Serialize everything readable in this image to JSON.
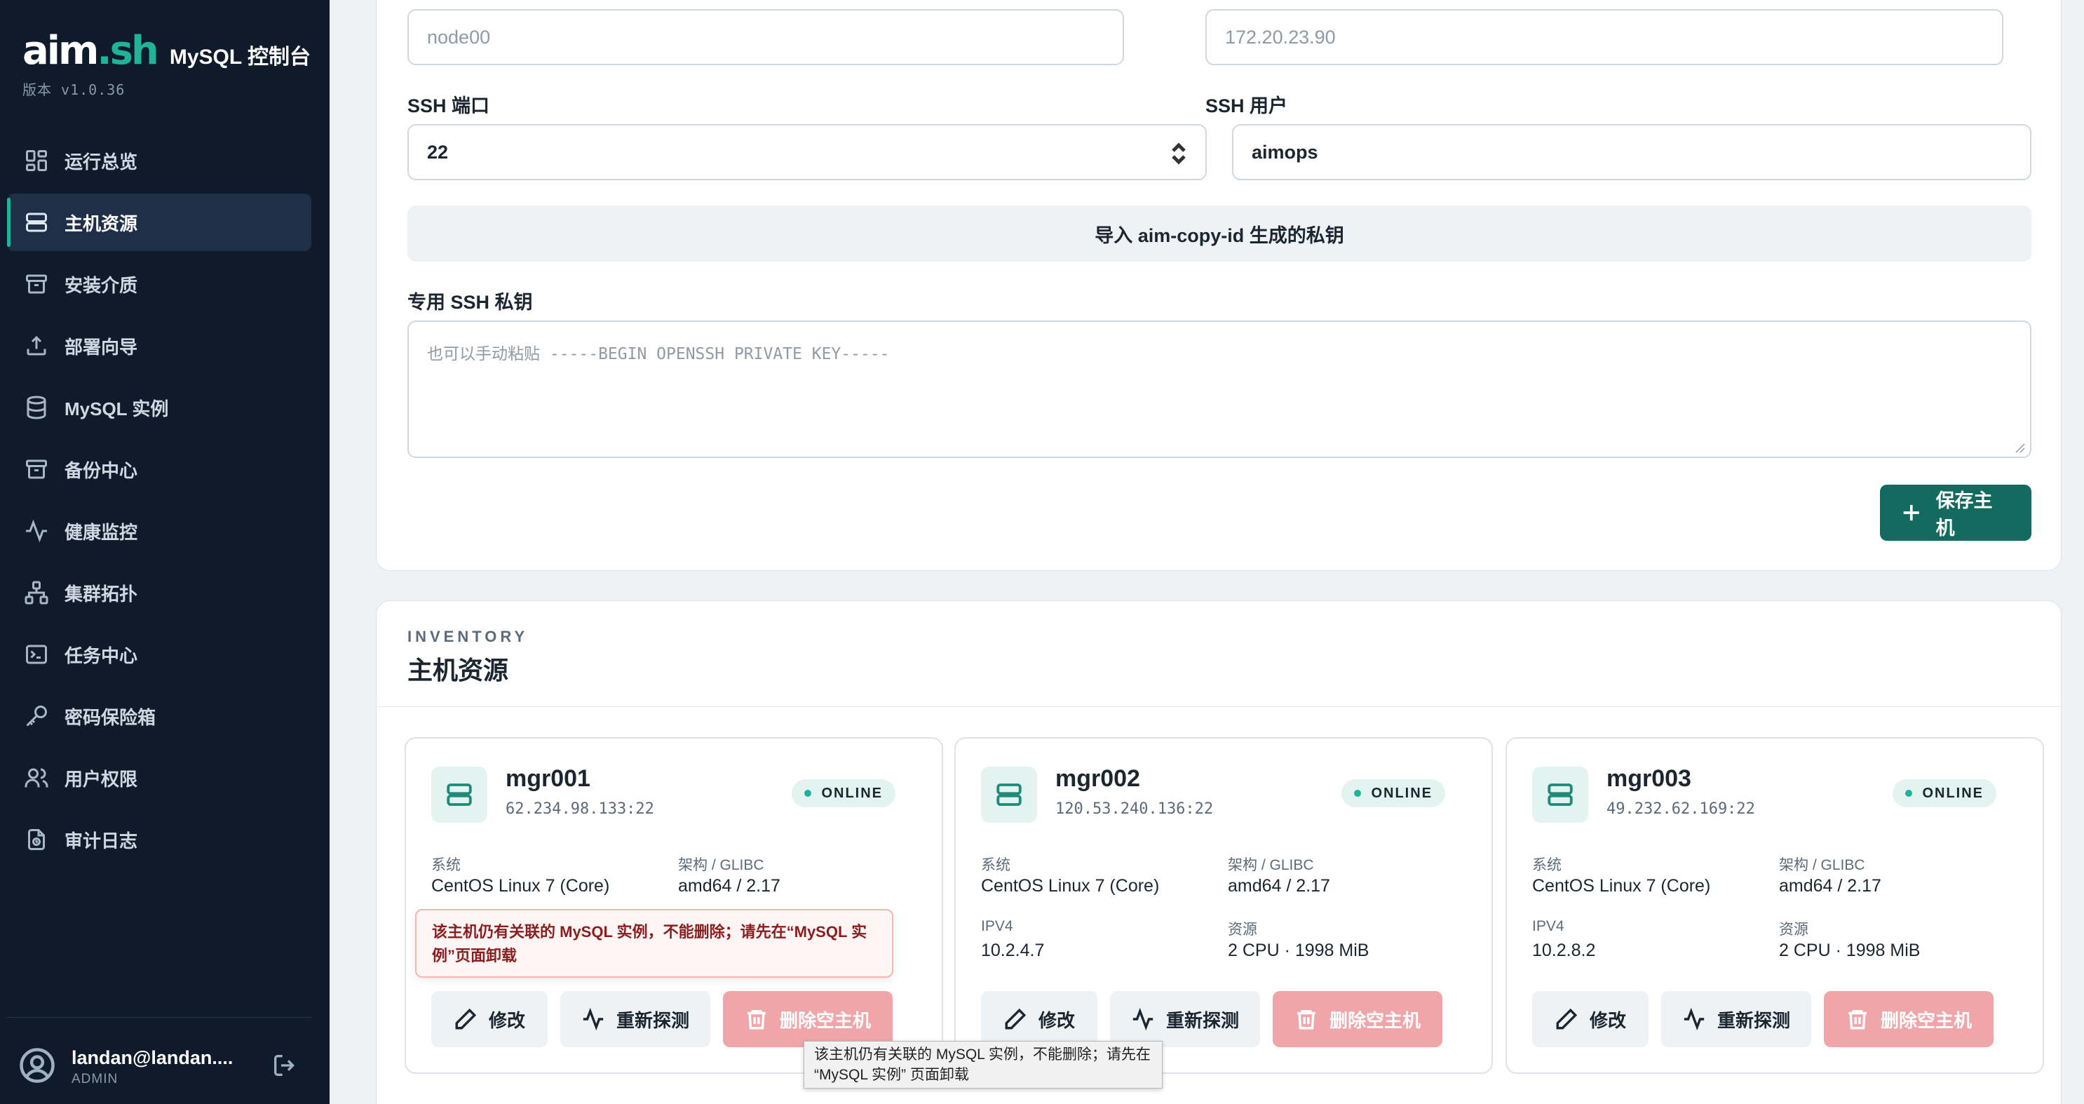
{
  "brand": {
    "logo_main": "aim",
    "logo_dot": ".",
    "logo_sh": "sh",
    "title": "MySQL 控制台",
    "version": "版本 v1.0.36"
  },
  "sidebar": {
    "items": [
      {
        "label": "运行总览",
        "icon": "dashboard-icon"
      },
      {
        "label": "主机资源",
        "icon": "server-icon",
        "active": true
      },
      {
        "label": "安装介质",
        "icon": "archive-icon"
      },
      {
        "label": "部署向导",
        "icon": "upload-icon"
      },
      {
        "label": "MySQL 实例",
        "icon": "database-icon"
      },
      {
        "label": "备份中心",
        "icon": "archive-icon"
      },
      {
        "label": "健康监控",
        "icon": "activity-icon"
      },
      {
        "label": "集群拓扑",
        "icon": "topology-icon"
      },
      {
        "label": "任务中心",
        "icon": "terminal-icon"
      },
      {
        "label": "密码保险箱",
        "icon": "key-icon"
      },
      {
        "label": "用户权限",
        "icon": "users-icon"
      },
      {
        "label": "审计日志",
        "icon": "audit-icon"
      }
    ]
  },
  "user": {
    "name": "landan@landan....",
    "role": "ADMIN"
  },
  "form": {
    "hostname_placeholder": "node00",
    "ip_placeholder": "172.20.23.90",
    "ssh_port_label": "SSH 端口",
    "ssh_port_value": "22",
    "ssh_user_label": "SSH 用户",
    "ssh_user_value": "aimops",
    "import_button": "导入 aim-copy-id 生成的私钥",
    "private_key_label": "专用 SSH 私钥",
    "private_key_placeholder": "也可以手动粘贴 -----BEGIN OPENSSH PRIVATE KEY-----",
    "save_button": "保存主机"
  },
  "inventory": {
    "eyebrow": "INVENTORY",
    "title": "主机资源",
    "labels": {
      "os": "系统",
      "arch": "架构 / GLIBC",
      "ipv4": "IPV4",
      "resources": "资源"
    },
    "buttons": {
      "edit": "修改",
      "reprobe": "重新探测",
      "delete": "删除空主机"
    },
    "hosts": [
      {
        "name": "mgr001",
        "addr": "62.234.98.133:22",
        "status": "ONLINE",
        "os": "CentOS Linux 7 (Core)",
        "arch": "amd64 / 2.17",
        "ipv4": "",
        "resources": ""
      },
      {
        "name": "mgr002",
        "addr": "120.53.240.136:22",
        "status": "ONLINE",
        "os": "CentOS Linux 7 (Core)",
        "arch": "amd64 / 2.17",
        "ipv4": "10.2.4.7",
        "resources": "2 CPU · 1998 MiB"
      },
      {
        "name": "mgr003",
        "addr": "49.232.62.169:22",
        "status": "ONLINE",
        "os": "CentOS Linux 7 (Core)",
        "arch": "amd64 / 2.17",
        "ipv4": "10.2.8.2",
        "resources": "2 CPU · 1998 MiB"
      }
    ]
  },
  "error_popup": "该主机仍有关联的 MySQL 实例，不能删除；请先在“MySQL 实例”页面卸载",
  "tooltip": "该主机仍有关联的 MySQL 实例，不能删除；请先在 “MySQL 实例” 页面卸载",
  "colors": {
    "sidebar_bg": "#0f1b2b",
    "accent": "#1fb39a",
    "primary_button": "#136b5f",
    "danger_button": "#f0a6a8"
  }
}
